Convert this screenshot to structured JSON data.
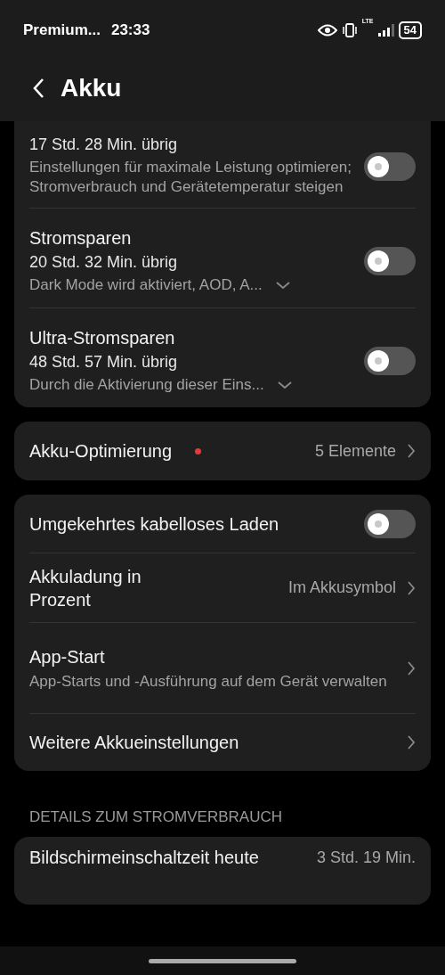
{
  "status_bar": {
    "carrier": "Premium...",
    "time": "23:33",
    "network": "LTE",
    "battery": "54"
  },
  "header": {
    "title": "Akku"
  },
  "modes": [
    {
      "kind": "toggle",
      "subtitle": "17 Std. 28 Min. übrig",
      "description": "Einstellungen für maximale Leistung optimieren; Stromverbrauch und Gerätetemperatur steigen",
      "on": false
    },
    {
      "kind": "toggle",
      "title": "Stromsparen",
      "subtitle": "20 Std. 32 Min. übrig",
      "description": "Dark Mode wird aktiviert, AOD, A...",
      "expanded": false,
      "on": false
    },
    {
      "kind": "toggle",
      "title": "Ultra-Stromsparen",
      "subtitle": "48 Std. 57 Min. übrig",
      "description": "Durch die Aktivierung dieser Eins...",
      "expanded": false,
      "on": false
    }
  ],
  "optimization": {
    "label": "Akku-Optimierung",
    "alert": true,
    "value": "5 Elemente"
  },
  "settings": [
    {
      "kind": "toggle",
      "title": "Umgekehrtes kabelloses Laden",
      "on": false
    },
    {
      "kind": "link",
      "title": "Akkuladung in Prozent",
      "value": "Im Akkusymbol"
    },
    {
      "kind": "link",
      "title": "App-Start",
      "description": "App-Starts und -Ausführung auf dem Gerät verwalten"
    },
    {
      "kind": "link",
      "title": "Weitere Akkueinstellungen"
    }
  ],
  "usage_section": {
    "heading": "DETAILS ZUM STROMVERBRAUCH",
    "rows": [
      {
        "label": "Bildschirmeinschaltzeit heute",
        "value": "3 Std. 19 Min."
      }
    ]
  }
}
